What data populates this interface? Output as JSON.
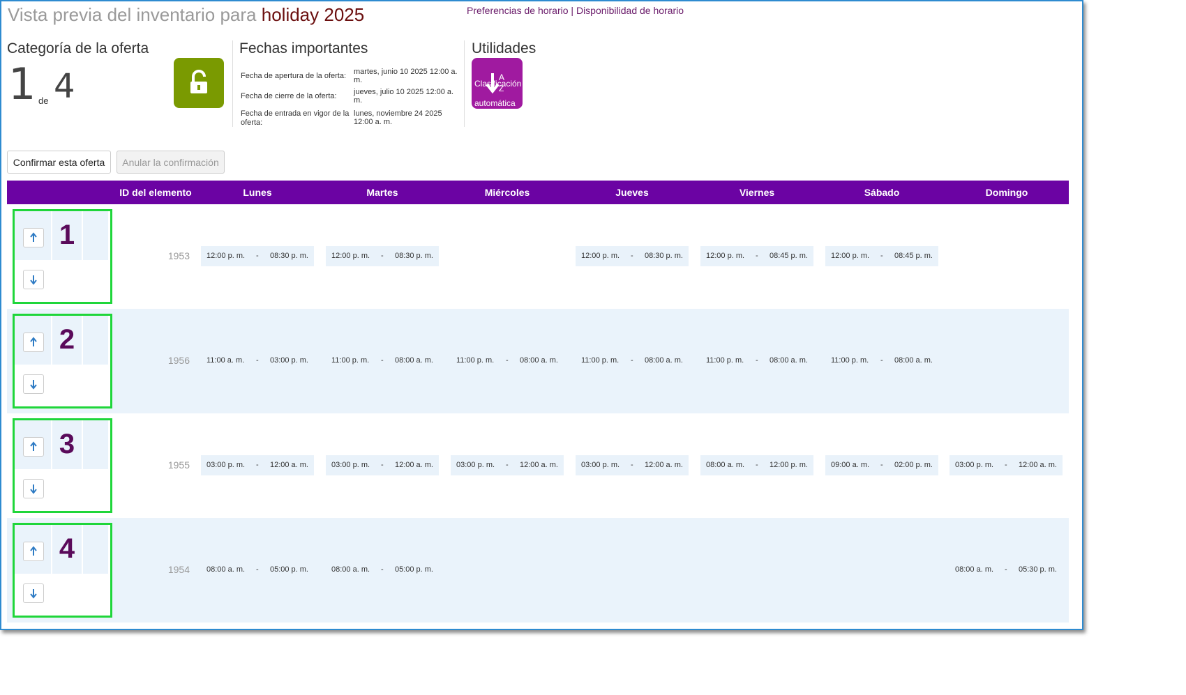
{
  "header": {
    "title_prefix": "Vista previa del inventario para",
    "title_accent": "holiday 2025",
    "link_preferences": "Preferencias de horario",
    "link_separator": "|",
    "link_availability": "Disponibilidad de horario"
  },
  "category": {
    "heading": "Categoría de la oferta",
    "current": "1",
    "of_label": "de",
    "total": "4"
  },
  "dates": {
    "heading": "Fechas importantes",
    "opening_label": "Fecha de apertura de la oferta:",
    "opening_value": "martes, junio 10 2025 12:00 a. m.",
    "closing_label": "Fecha de cierre de la oferta:",
    "closing_value": "jueves, julio 10 2025 12:00 a. m.",
    "effective_label": "Fecha de entrada en vigor de la oferta:",
    "effective_value": "lunes, noviembre 24 2025 12:00 a. m."
  },
  "utilities": {
    "heading": "Utilidades",
    "auto_sort_line1": "Clasificación",
    "auto_sort_line2": "automática"
  },
  "actions": {
    "confirm": "Confirmar esta oferta",
    "cancel": "Anular la confirmación"
  },
  "table": {
    "columns": [
      "ID del elemento",
      "Lunes",
      "Martes",
      "Miércoles",
      "Jueves",
      "Viernes",
      "Sábado",
      "Domingo"
    ],
    "separator": "-",
    "rows": [
      {
        "rank": "1",
        "id": "1953",
        "days": [
          {
            "start": "12:00 p. m.",
            "end": "08:30 p. m.",
            "boxed": true
          },
          {
            "start": "12:00 p. m.",
            "end": "08:30 p. m.",
            "boxed": true
          },
          null,
          {
            "start": "12:00 p. m.",
            "end": "08:30 p. m.",
            "boxed": true
          },
          {
            "start": "12:00 p. m.",
            "end": "08:45 p. m.",
            "boxed": true
          },
          {
            "start": "12:00 p. m.",
            "end": "08:45 p. m.",
            "boxed": true
          },
          null
        ]
      },
      {
        "rank": "2",
        "id": "1956",
        "days": [
          {
            "start": "11:00 a. m.",
            "end": "03:00 p. m.",
            "boxed": false
          },
          {
            "start": "11:00 p. m.",
            "end": "08:00 a. m.",
            "boxed": false
          },
          {
            "start": "11:00 p. m.",
            "end": "08:00 a. m.",
            "boxed": false
          },
          {
            "start": "11:00 p. m.",
            "end": "08:00 a. m.",
            "boxed": false
          },
          {
            "start": "11:00 p. m.",
            "end": "08:00 a. m.",
            "boxed": false
          },
          {
            "start": "11:00 p. m.",
            "end": "08:00 a. m.",
            "boxed": false
          },
          null
        ]
      },
      {
        "rank": "3",
        "id": "1955",
        "days": [
          {
            "start": "03:00 p. m.",
            "end": "12:00 a. m.",
            "boxed": true
          },
          {
            "start": "03:00 p. m.",
            "end": "12:00 a. m.",
            "boxed": true
          },
          {
            "start": "03:00 p. m.",
            "end": "12:00 a. m.",
            "boxed": true
          },
          {
            "start": "03:00 p. m.",
            "end": "12:00 a. m.",
            "boxed": true
          },
          {
            "start": "08:00 a. m.",
            "end": "12:00 p. m.",
            "boxed": true
          },
          {
            "start": "09:00 a. m.",
            "end": "02:00 p. m.",
            "boxed": true
          },
          {
            "start": "03:00 p. m.",
            "end": "12:00 a. m.",
            "boxed": true
          }
        ]
      },
      {
        "rank": "4",
        "id": "1954",
        "days": [
          {
            "start": "08:00 a. m.",
            "end": "05:00 p. m.",
            "boxed": false
          },
          {
            "start": "08:00 a. m.",
            "end": "05:00 p. m.",
            "boxed": false
          },
          null,
          null,
          null,
          null,
          {
            "start": "08:00 a. m.",
            "end": "05:30 p. m.",
            "boxed": false
          }
        ]
      }
    ]
  },
  "colors": {
    "header_bar": "#6b03a3",
    "accent_title": "#6b0f0f",
    "lock_button": "#7a9a01",
    "auto_sort_button": "#a01aa0",
    "rank_highlight": "#1fd63a",
    "rank_number": "#5a0a5a"
  }
}
